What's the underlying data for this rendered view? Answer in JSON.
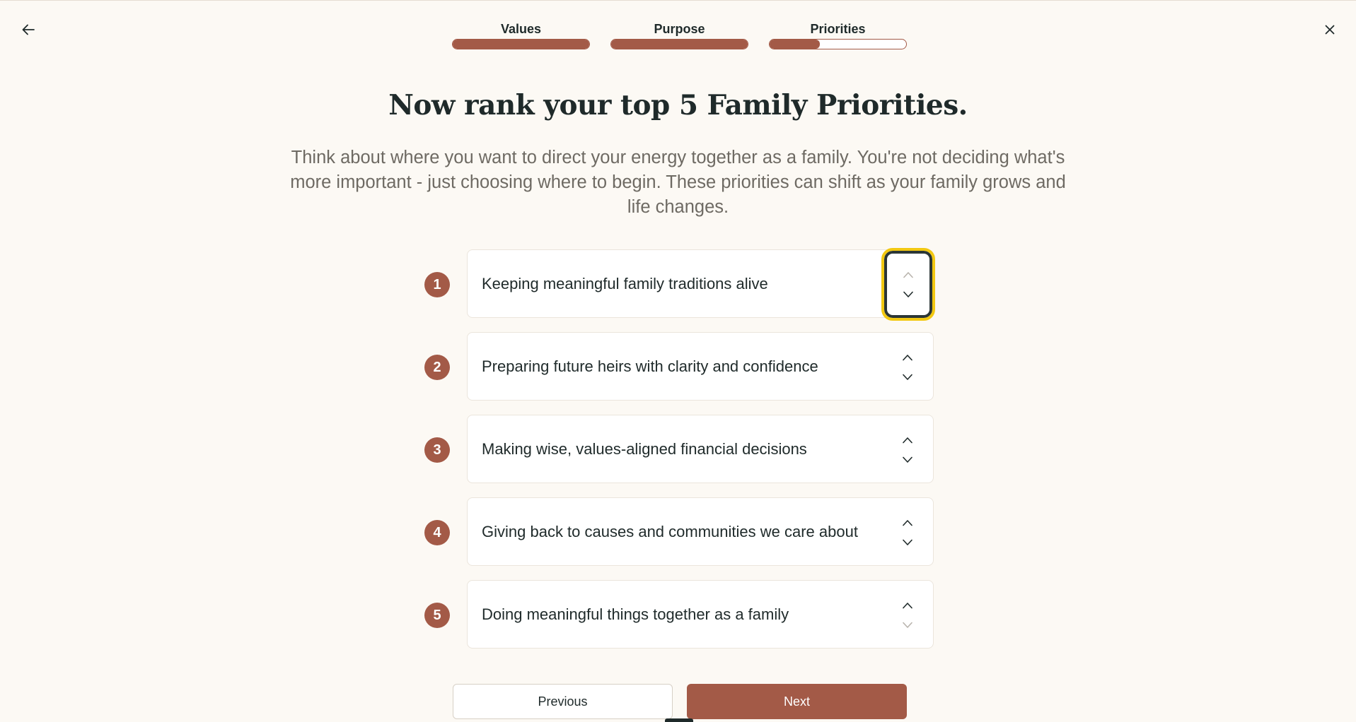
{
  "nav": {
    "back_icon": "arrow-left-icon",
    "close_icon": "close-icon"
  },
  "stepper": {
    "steps": [
      {
        "label": "Values",
        "progress": 1.0
      },
      {
        "label": "Purpose",
        "progress": 1.0
      },
      {
        "label": "Priorities",
        "progress": 0.37
      }
    ]
  },
  "header": {
    "title": "Now rank your top 5 Family Priorities.",
    "subtitle": "Think about where you want to direct your energy together as a family. You're not deciding what's more important - just choosing where to begin. These priorities can shift as your family grows and life changes."
  },
  "priorities": [
    {
      "rank": "1",
      "label": "Keeping meaningful family traditions alive",
      "up_disabled": true,
      "down_disabled": false,
      "focused": true
    },
    {
      "rank": "2",
      "label": "Preparing future heirs with clarity and confidence",
      "up_disabled": false,
      "down_disabled": false,
      "focused": false
    },
    {
      "rank": "3",
      "label": "Making wise, values-aligned financial decisions",
      "up_disabled": false,
      "down_disabled": false,
      "focused": false
    },
    {
      "rank": "4",
      "label": "Giving back to causes and communities we care about",
      "up_disabled": false,
      "down_disabled": false,
      "focused": false
    },
    {
      "rank": "5",
      "label": "Doing meaningful things together as a family",
      "up_disabled": false,
      "down_disabled": true,
      "focused": false
    }
  ],
  "footer": {
    "previous_label": "Previous",
    "next_label": "Next"
  },
  "colors": {
    "accent": "#a35a47",
    "background": "#fcf9f4",
    "focus_ring": "#f2c811"
  }
}
